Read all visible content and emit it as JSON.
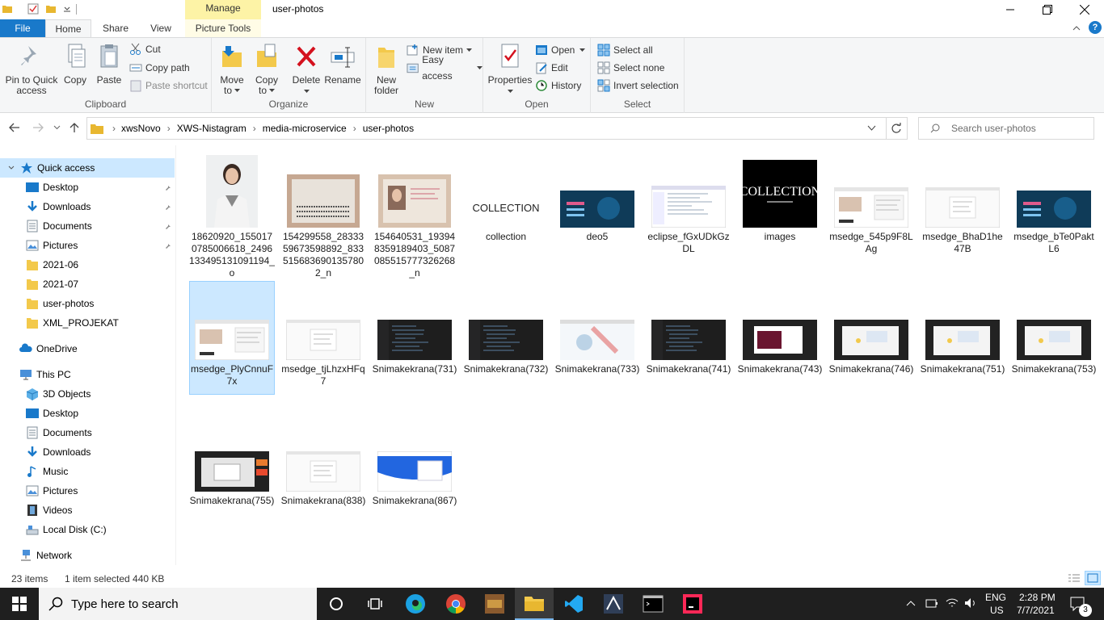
{
  "window": {
    "title": "user-photos",
    "context_tab": "Manage",
    "colors": {
      "accent": "#1979ca",
      "selection": "#cce8ff",
      "manage_tab": "#fdf3a6"
    }
  },
  "tabs": {
    "file": "File",
    "home": "Home",
    "share": "Share",
    "view": "View",
    "picture_tools": "Picture Tools"
  },
  "ribbon": {
    "clipboard": {
      "label": "Clipboard",
      "pin_line1": "Pin to Quick",
      "pin_line2": "access",
      "copy": "Copy",
      "paste": "Paste",
      "cut": "Cut",
      "copy_path": "Copy path",
      "paste_shortcut": "Paste shortcut"
    },
    "organize": {
      "label": "Organize",
      "move_line1": "Move",
      "move_line2": "to",
      "copy_line1": "Copy",
      "copy_line2": "to",
      "delete": "Delete",
      "rename": "Rename"
    },
    "new": {
      "label": "New",
      "folder_line1": "New",
      "folder_line2": "folder",
      "new_item": "New item",
      "easy_access": "Easy access"
    },
    "open": {
      "label": "Open",
      "properties": "Properties",
      "open": "Open",
      "edit": "Edit",
      "history": "History"
    },
    "select": {
      "label": "Select",
      "select_all": "Select all",
      "select_none": "Select none",
      "invert": "Invert selection"
    }
  },
  "address": {
    "crumbs": [
      "xwsNovo",
      "XWS-Nistagram",
      "media-microservice",
      "user-photos"
    ],
    "search_placeholder": "Search user-photos"
  },
  "nav": {
    "quick_access": "Quick access",
    "quick_items": [
      "Desktop",
      "Downloads",
      "Documents",
      "Pictures",
      "2021-06",
      "2021-07",
      "user-photos",
      "XML_PROJEKAT"
    ],
    "onedrive": "OneDrive",
    "this_pc": "This PC",
    "pc_items": [
      "3D Objects",
      "Desktop",
      "Documents",
      "Downloads",
      "Music",
      "Pictures",
      "Videos",
      "Local Disk (C:)"
    ],
    "network": "Network"
  },
  "files": [
    {
      "name": "18620920_1550170785006618_2496133495131091194_o",
      "icon": "portrait-photo"
    },
    {
      "name": "154299558_2833359673598892_8335156836901357802_n",
      "icon": "id-card-back"
    },
    {
      "name": "154640531_1939483591894​03_5087085515777326268_n",
      "icon": "id-card-front"
    },
    {
      "name": "collection",
      "icon": "collection-text"
    },
    {
      "name": "deo5",
      "icon": "dark-blue-slide"
    },
    {
      "name": "eclipse_fGxUDkGzDL",
      "icon": "ide-screenshot"
    },
    {
      "name": "images",
      "icon": "collection-logo"
    },
    {
      "name": "msedge_545p9F8LAg",
      "icon": "browser-screenshot"
    },
    {
      "name": "msedge_BhaD1he47B",
      "icon": "white-screenshot"
    },
    {
      "name": "msedge_bTe0PaktL6",
      "icon": "dark-blue-slide"
    },
    {
      "name": "msedge_PlyCnnuF7x",
      "icon": "browser-screenshot"
    },
    {
      "name": "msedge_tjLhzxHFq7",
      "icon": "white-screenshot"
    },
    {
      "name": "Snimakekrana(731)",
      "icon": "dark-code"
    },
    {
      "name": "Snimakekrana(732)",
      "icon": "dark-code"
    },
    {
      "name": "Snimakekrana(733)",
      "icon": "light-web"
    },
    {
      "name": "Snimakekrana(741)",
      "icon": "dark-code"
    },
    {
      "name": "Snimakekrana(743)",
      "icon": "dark-red"
    },
    {
      "name": "Snimakekrana(746)",
      "icon": "dark-web"
    },
    {
      "name": "Snimakekrana(751)",
      "icon": "dark-web"
    },
    {
      "name": "Snimakekrana(753)",
      "icon": "dark-web"
    },
    {
      "name": "Snimakekrana(755)",
      "icon": "dark-orange"
    },
    {
      "name": "Snimakekrana(838)",
      "icon": "white-screenshot"
    },
    {
      "name": "Snimakekrana(867)",
      "icon": "blue-web"
    }
  ],
  "selected_file": "msedge_PlyCnnuF7x",
  "status": {
    "items": "23 items",
    "selection": "1 item selected  440 KB"
  },
  "taskbar": {
    "search_placeholder": "Type here to search",
    "lang1": "ENG",
    "lang2": "US",
    "time": "2:28 PM",
    "date": "7/7/2021",
    "notifications": "3"
  }
}
